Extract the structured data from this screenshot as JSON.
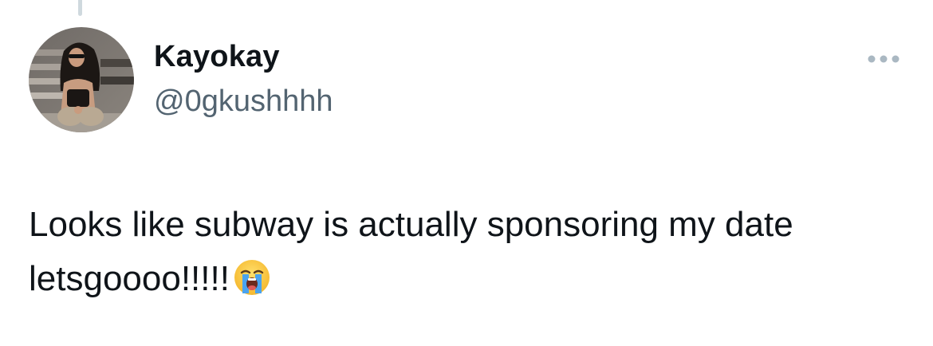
{
  "tweet": {
    "author": {
      "display_name": "Kayokay",
      "handle": "@0gkushhhh",
      "avatar_icon": "profile-photo"
    },
    "text": "Looks like subway is actually sponsoring my date letsgoooo!!!!!",
    "emoji": "loudly-crying-face",
    "more_icon": "more-options-icon"
  },
  "colors": {
    "text_primary": "#0f1419",
    "text_secondary": "#536471",
    "thread_line": "#cfd9de",
    "more_icon": "#536471"
  }
}
